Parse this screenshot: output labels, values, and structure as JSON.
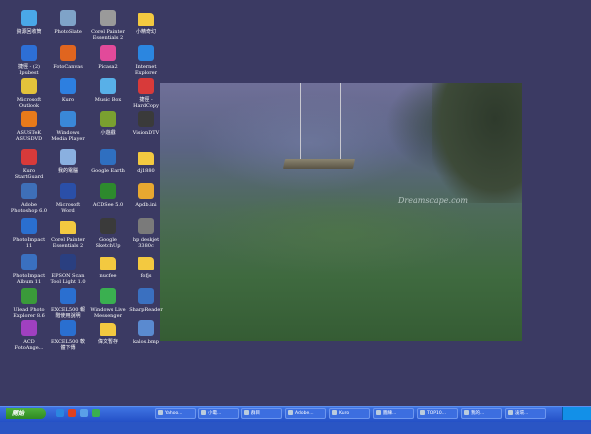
{
  "desktop": {
    "icons": [
      {
        "id": "recycle-bin",
        "label": "資源回收筒",
        "icon": "recycle-bin-icon",
        "color": "#4aa8e8"
      },
      {
        "id": "photoslate",
        "label": "PhotoSlate",
        "icon": "photo-icon",
        "color": "#7fa3c8"
      },
      {
        "id": "corel-essentials2",
        "label": "Corel Painter\nEssentials 2",
        "icon": "corel-icon",
        "color": "#9a9a9a"
      },
      {
        "id": "xiaojin-folder",
        "label": "小精奇幻",
        "icon": "folder-icon",
        "color": "#f3c940"
      },
      {
        "id": "shortcut-ipubest",
        "label": "捷徑 - (2)\nIpubest",
        "icon": "globe-icon",
        "color": "#2d6fd6"
      },
      {
        "id": "fotocanvas",
        "label": "FotoCanvas",
        "icon": "fotocanvas-icon",
        "color": "#e0651f"
      },
      {
        "id": "picasa2",
        "label": "Picasa2",
        "icon": "picasa-icon",
        "color": "#e24a9a"
      },
      {
        "id": "internet-explorer",
        "label": "Internet\nExplorer",
        "icon": "ie-icon",
        "color": "#2b86e0"
      },
      {
        "id": "outlook",
        "label": "Microsoft\nOutlook",
        "icon": "outlook-icon",
        "color": "#e3c23b"
      },
      {
        "id": "kuro",
        "label": "Kuro",
        "icon": "kuro-icon",
        "color": "#2d7fe0"
      },
      {
        "id": "music-box",
        "label": "Music Box",
        "icon": "music-box-icon",
        "color": "#58b0e8"
      },
      {
        "id": "hardcopy",
        "label": "捷徑 -\nHardCopy",
        "icon": "hardcopy-icon",
        "color": "#d83a3a"
      },
      {
        "id": "asustek-dvd",
        "label": "ASUSTeK\nASUSDVD",
        "icon": "dvd-icon",
        "color": "#e87a1a"
      },
      {
        "id": "media-player",
        "label": "Windows\nMedia Player",
        "icon": "media-player-icon",
        "color": "#3a88d8"
      },
      {
        "id": "xiaoyouxi",
        "label": "小遊戲",
        "icon": "game-icon",
        "color": "#7aa030"
      },
      {
        "id": "visiondtv",
        "label": "VisionDTV",
        "icon": "tv-icon",
        "color": "#3a3a3a"
      },
      {
        "id": "kuro-startguard",
        "label": "Kuro\nStartGuard",
        "icon": "kuro-guard-icon",
        "color": "#d83a3a"
      },
      {
        "id": "my-computer",
        "label": "我的電腦",
        "icon": "computer-icon",
        "color": "#8ab0e0"
      },
      {
        "id": "google-earth",
        "label": "Google Earth",
        "icon": "earth-icon",
        "color": "#2f6fc0"
      },
      {
        "id": "dj1880",
        "label": "dj1880",
        "icon": "folder-icon",
        "color": "#f3c940"
      },
      {
        "id": "photoshop",
        "label": "Adobe\nPhotoshop 6.0",
        "icon": "photoshop-icon",
        "color": "#3e6fb8"
      },
      {
        "id": "word",
        "label": "Microsoft\nWord",
        "icon": "word-icon",
        "color": "#2a4fa8"
      },
      {
        "id": "acdsee",
        "label": "ACDSee 5.0",
        "icon": "acdsee-icon",
        "color": "#2d8a2d"
      },
      {
        "id": "apdb-ini",
        "label": "Apdb.ini",
        "icon": "ini-file-icon",
        "color": "#e8a830"
      },
      {
        "id": "photoimpact11",
        "label": "PhotoImpact\n11",
        "icon": "photoimpact-icon",
        "color": "#2a6fd0"
      },
      {
        "id": "corel-essentials2-folder",
        "label": "Corel Painter\nEssentials 2",
        "icon": "folder-icon",
        "color": "#f3c940"
      },
      {
        "id": "google-sketchup",
        "label": "Google\nSketchUp",
        "icon": "sketchup-icon",
        "color": "#3a3a3a"
      },
      {
        "id": "hp-deskjet",
        "label": "hp deskjet\n3380c",
        "icon": "printer-icon",
        "color": "#7a7a7a"
      },
      {
        "id": "photoimpact-album",
        "label": "PhotoImpact\nAlbum 11",
        "icon": "album-icon",
        "color": "#3a70c0"
      },
      {
        "id": "epson-tool",
        "label": "EPSON Scan\nTool Light 1.0",
        "icon": "scanner-icon",
        "color": "#2a3f80"
      },
      {
        "id": "nucfee",
        "label": "nucfee",
        "icon": "folder-icon",
        "color": "#f3c940"
      },
      {
        "id": "fofjs",
        "label": "fofjs",
        "icon": "folder-icon",
        "color": "#f3c940"
      },
      {
        "id": "ulead-explorer",
        "label": "Ulead Photo\nExplorer 8.6",
        "icon": "ulead-icon",
        "color": "#3a9a3a"
      },
      {
        "id": "eeecx1",
        "label": "EXCEL500 報\n階使用說明",
        "icon": "excel-doc-icon",
        "color": "#2a6fd0"
      },
      {
        "id": "live-messenger",
        "label": "Windows Live\nMessenger",
        "icon": "messenger-icon",
        "color": "#3ab050"
      },
      {
        "id": "sharpreader",
        "label": "SharpReader",
        "icon": "rss-icon",
        "color": "#3a70c0"
      },
      {
        "id": "acd-fotoangelo",
        "label": "ACD\nFotoAnge...",
        "icon": "acd-icon",
        "color": "#a040c0"
      },
      {
        "id": "eeecx2",
        "label": "EXCEL500 軟\n體下傳",
        "icon": "excel-doc-icon",
        "color": "#2a6fd0"
      },
      {
        "id": "weiwen-folder",
        "label": "偉文暫存",
        "icon": "folder-icon",
        "color": "#f3c940"
      },
      {
        "id": "kalos-bmp",
        "label": "kalos.bmp",
        "icon": "bmp-file-icon",
        "color": "#5a8ad0"
      }
    ],
    "wallpaper_watermark": "Dreamscape.com"
  },
  "taskbar": {
    "start_label": "開始",
    "quick_launch": [
      {
        "icon": "ie-quicklaunch-icon",
        "color": "#2b86e0"
      },
      {
        "icon": "media-quicklaunch-icon",
        "color": "#e04020"
      },
      {
        "icon": "desktop-quicklaunch-icon",
        "color": "#5aa0e8"
      },
      {
        "icon": "messenger-quicklaunch-icon",
        "color": "#3ab050"
      }
    ],
    "tasks": [
      {
        "label": "Yahoo...",
        "icon": "browser-icon"
      },
      {
        "label": "小電...",
        "icon": "messenger-icon"
      },
      {
        "label": "群目",
        "icon": "folder-icon"
      },
      {
        "label": "Adobe...",
        "icon": "photoshop-icon"
      },
      {
        "label": "Kuro",
        "icon": "kuro-icon"
      },
      {
        "label": "圖練...",
        "icon": "image-icon"
      },
      {
        "label": "TOP10...",
        "icon": "browser-icon"
      },
      {
        "label": "我的...",
        "icon": "computer-icon"
      },
      {
        "label": "凌環...",
        "icon": "window-icon"
      }
    ]
  }
}
